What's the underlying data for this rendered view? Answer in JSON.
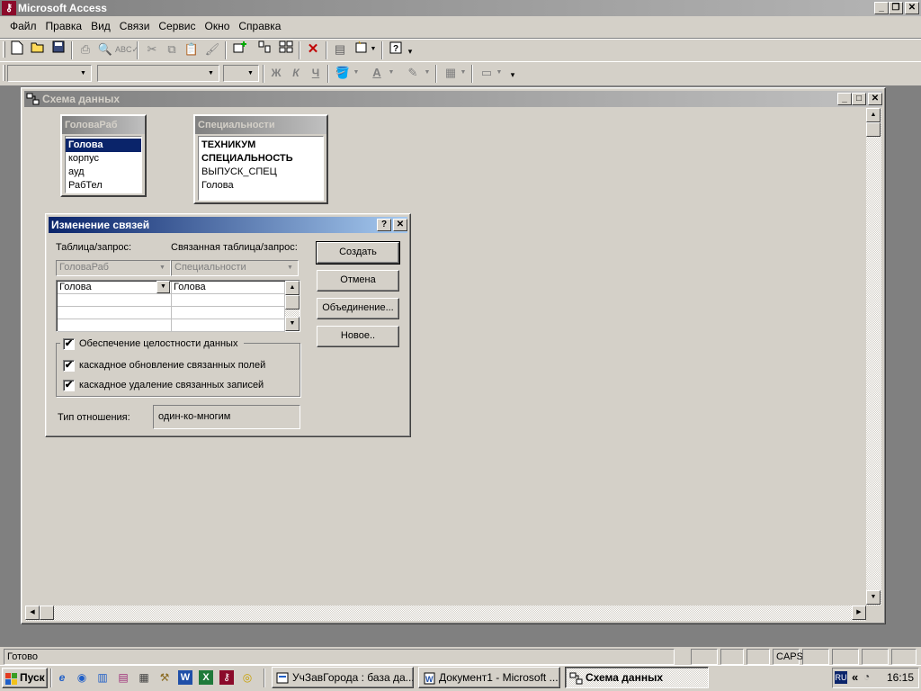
{
  "app": {
    "title": "Microsoft Access",
    "ctrl_min": "_",
    "ctrl_restore": "❐",
    "ctrl_close": "✕"
  },
  "menu": [
    "Файл",
    "Правка",
    "Вид",
    "Связи",
    "Сервис",
    "Окно",
    "Справка"
  ],
  "toolbar": {
    "buttons": [
      "new-icon",
      "open-icon",
      "save-icon",
      "print-icon",
      "print-preview-icon",
      "spelling-icon",
      "cut-icon",
      "copy-icon",
      "paste-icon",
      "format-painter-icon",
      "show-table-icon",
      "show-direct-icon",
      "show-all-icon",
      "delete-icon",
      "properties-icon",
      "new-object-icon",
      "help-icon"
    ],
    "format_bold": "Ж",
    "format_italic": "К",
    "format_underline": "Ч"
  },
  "child_window": {
    "title": "Схема данных",
    "ctrl_min": "_",
    "ctrl_max": "□",
    "ctrl_close": "✕"
  },
  "tables": [
    {
      "title": "ГоловаРаб",
      "fields": [
        "Голова",
        "корпус",
        "ауд",
        "РабТел"
      ],
      "selected": 0
    },
    {
      "title": "Специальности",
      "fields": [
        "ТЕХНИКУМ",
        "СПЕЦИАЛЬНОСТЬ",
        "ВЫПУСК_СПЕЦ",
        "Голова"
      ],
      "key_fields": [
        0,
        1
      ]
    }
  ],
  "dialog": {
    "title": "Изменение связей",
    "help": "?",
    "close": "✕",
    "table_label": "Таблица/запрос:",
    "related_label": "Связанная таблица/запрос:",
    "table_value": "ГоловаРаб",
    "related_value": "Специальности",
    "grid_left": "Голова",
    "grid_right": "Голова",
    "integrity_label": "Обеспечение целостности данных",
    "cascade_update_label": "каскадное обновление связанных полей",
    "cascade_delete_label": "каскадное удаление связанных записей",
    "integrity_checked": true,
    "cascade_update_checked": true,
    "cascade_delete_checked": true,
    "relation_type_label": "Тип отношения:",
    "relation_type_value": "один-ко-многим",
    "btn_create": "Создать",
    "btn_cancel": "Отмена",
    "btn_join": "Объединение...",
    "btn_new": "Новое.."
  },
  "status": {
    "text": "Готово",
    "caps": "CAPS"
  },
  "taskbar": {
    "start": "Пуск",
    "tasks": [
      "УчЗавГорода : база да...",
      "Документ1 - Microsoft ...",
      "Схема данных"
    ],
    "lang": "RU",
    "chevron": "«",
    "clock": "16:15"
  }
}
